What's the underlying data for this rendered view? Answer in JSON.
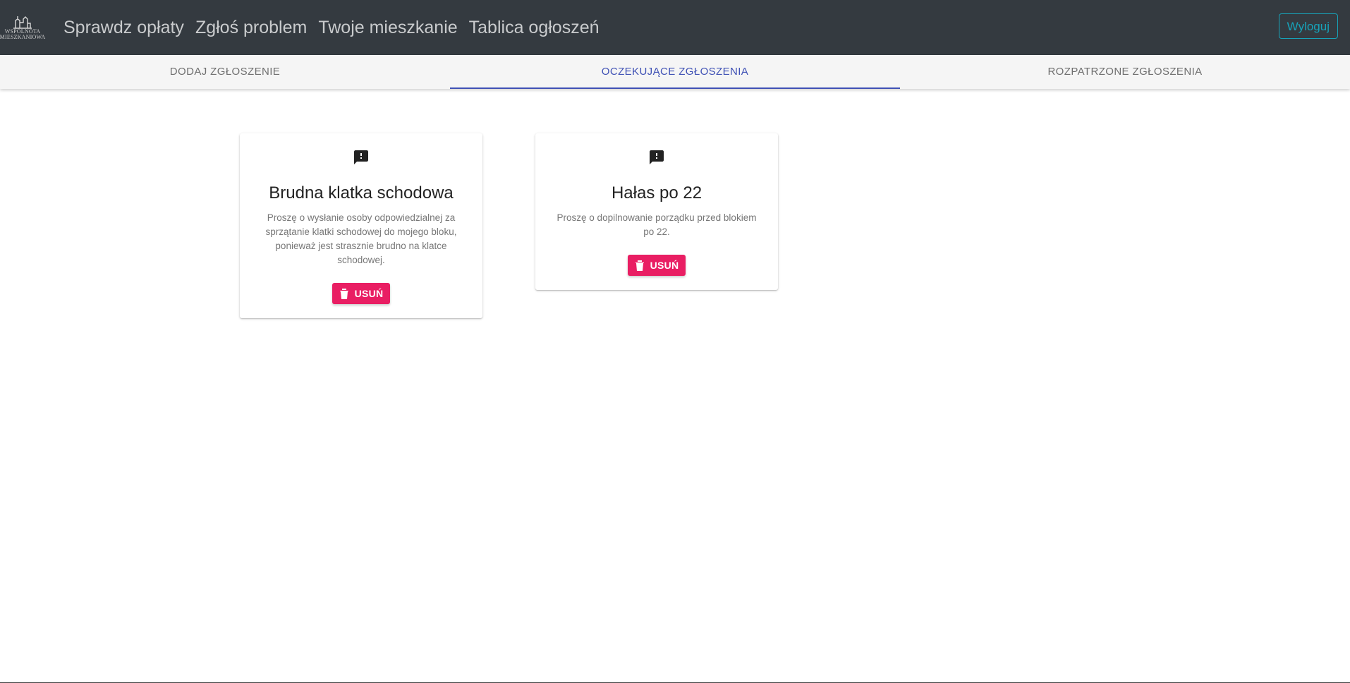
{
  "navbar": {
    "brand": {
      "line1": "WSPÓLNOTA",
      "line2": "MIESZKANIOWA"
    },
    "links": [
      "Sprawdz opłaty",
      "Zgłoś problem",
      "Twoje mieszkanie",
      "Tablica ogłoszeń"
    ],
    "logout_label": "Wyloguj"
  },
  "tabs": [
    {
      "label": "DODAJ ZGŁOSZENIE"
    },
    {
      "label": "OCZEKUJĄCE ZGŁOSZENIA",
      "active": true
    },
    {
      "label": "ROZPATRZONE ZGŁOSZENIA"
    }
  ],
  "cards": [
    {
      "icon": "feedback-icon",
      "title": "Brudna klatka schodowa",
      "text": "Proszę o wysłanie osoby odpowiedzialnej za sprzątanie klatki schodowej do mojego bloku, ponieważ jest strasznie brudno na klatce schodowej.",
      "delete_label": "USUŃ"
    },
    {
      "icon": "feedback-icon",
      "title": "Hałas po 22",
      "text": "Proszę o dopilnowanie porządku przed blokiem po 22.",
      "delete_label": "USUŃ"
    }
  ],
  "colors": {
    "navbar_bg": "#343a40",
    "accent": "#3f51b5",
    "delete": "#e91e63",
    "logout": "#17a2b8"
  }
}
